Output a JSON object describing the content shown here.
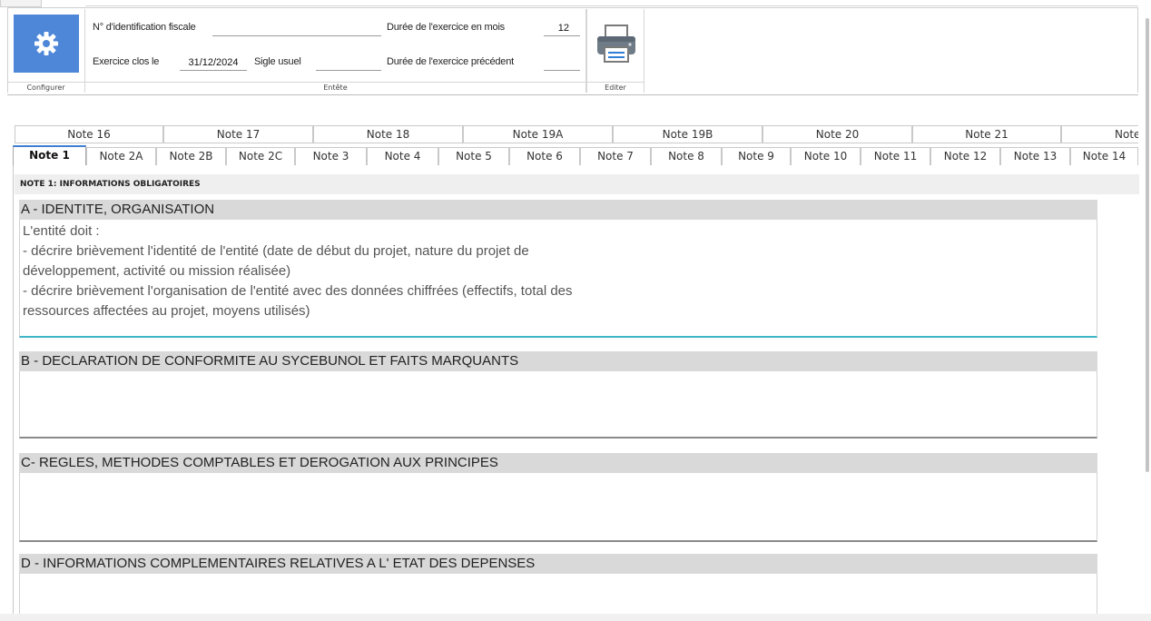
{
  "ribbon": {
    "groups": {
      "configurer": "Configurer",
      "entete": "Entête",
      "editer": "Editer"
    },
    "fields": {
      "nif_label": "N° d'identification fiscale",
      "nif_value": "",
      "exercice_label": "Exercice clos le",
      "exercice_value": "31/12/2024",
      "sigle_label": "Sigle usuel",
      "sigle_value": "",
      "duree_label": "Durée de l'exercice en mois",
      "duree_value": "12",
      "duree_prec_label": "Durée de l'exercice précédent",
      "duree_prec_value": ""
    },
    "icons": {
      "configurer": "gear-icon",
      "editer": "printer-icon"
    },
    "accent": "#4e86d8"
  },
  "tabs": {
    "back_row": [
      "Note 16",
      "Note 17",
      "Note 18",
      "Note 19A",
      "Note 19B",
      "Note 20",
      "Note 21",
      "Note"
    ],
    "front_row": [
      "Note 1",
      "Note 2A",
      "Note 2B",
      "Note 2C",
      "Note 3",
      "Note 4",
      "Note 5",
      "Note 6",
      "Note 7",
      "Note 8",
      "Note 9",
      "Note 10",
      "Note 11",
      "Note 12",
      "Note 13",
      "Note 14"
    ],
    "active": "Note 1"
  },
  "page": {
    "note_title": "NOTE 1: INFORMATIONS OBLIGATOIRES",
    "sections": [
      {
        "title": "A - IDENTITE, ORGANISATION",
        "lines": [
          "L'entité doit :",
          "- décrire brièvement l'identité de l'entité (date de début du projet, nature du projet de",
          "développement, activité ou mission réalisée)",
          "- décrire brièvement l'organisation de l'entité avec des données chiffrées (effectifs, total des",
          "ressources affectées au projet, moyens utilisés)"
        ]
      },
      {
        "title": "B - DECLARATION DE CONFORMITE AU SYCEBUNOL ET FAITS MARQUANTS",
        "lines": []
      },
      {
        "title": "C- REGLES, METHODES COMPTABLES ET DEROGATION AUX PRINCIPES",
        "lines": []
      },
      {
        "title": "D - INFORMATIONS COMPLEMENTAIRES RELATIVES A L' ETAT DES DEPENSES",
        "lines": []
      }
    ]
  },
  "colors": {
    "tab_active_accent": "#3f7fd0",
    "section_a_underline": "#3fb3c8"
  }
}
